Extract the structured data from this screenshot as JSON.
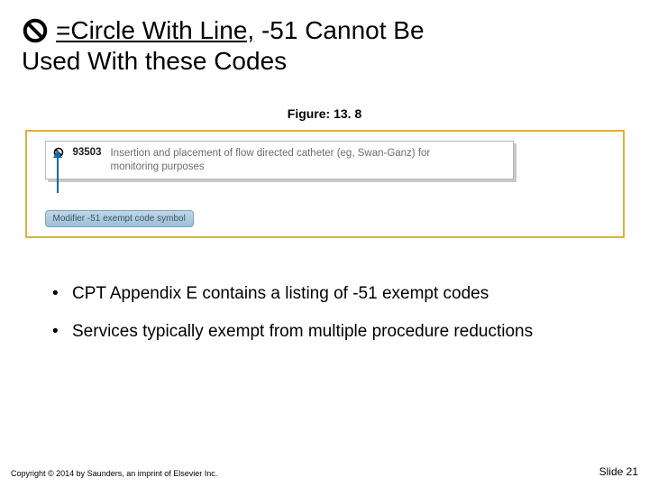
{
  "title": {
    "underlined": "=Circle With Line,",
    "rest1": " -51 Cannot Be",
    "line2": "Used With these Codes"
  },
  "figure": {
    "label": "Figure: 13. 8",
    "code": "93503",
    "desc": "Insertion and placement of flow directed catheter (eg, Swan-Ganz) for monitoring purposes",
    "pill": "Modifier -51 exempt code symbol"
  },
  "bullets": {
    "b1": "CPT Appendix E contains a listing of -51 exempt codes",
    "b2": "Services typically exempt from multiple procedure reductions"
  },
  "footer": {
    "copyright": "Copyright © 2014 by Saunders, an imprint of Elsevier Inc.",
    "slide": "Slide 21"
  }
}
